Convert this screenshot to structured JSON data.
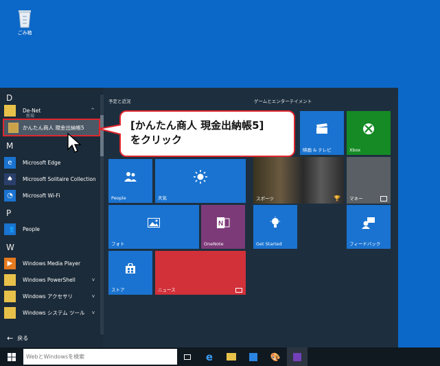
{
  "desktop": {
    "recycle_bin_label": "ごみ箱",
    "recycle_bin_icon": "recycle-bin-icon"
  },
  "start_menu": {
    "apps": {
      "letter_d": "D",
      "denet_label": "De-Net",
      "denet_sub": "新規",
      "highlight_label": "かんたん商人 現金出納帳5",
      "letter_m": "M",
      "edge_label": "Microsoft Edge",
      "solitaire_label": "Microsoft Solitaire Collection",
      "wifi_label": "Microsoft Wi-Fi",
      "letter_p": "P",
      "people_label": "People",
      "letter_w": "W",
      "wmp_label": "Windows Media Player",
      "powershell_label": "Windows PowerShell",
      "accessories_label": "Windows アクセサリ",
      "systemtools_label": "Windows システム ツール",
      "back_label": "戻る"
    },
    "groups": {
      "left_title": "予定と近況",
      "right_title": "ゲームとエンターテイメント"
    },
    "tiles": {
      "people": "People",
      "weather": "天気",
      "photo": "フォト",
      "onenote": "OneNote",
      "store": "ストア",
      "news": "ニュース",
      "movies": "映画 & テレビ",
      "xbox": "Xbox",
      "sports": "スポーツ",
      "money": "マネー",
      "getstarted": "Get Started",
      "feedback": "フィードバック"
    }
  },
  "callout": {
    "line1": "[かんたん商人 現金出納帳5]",
    "line2": "をクリック"
  },
  "taskbar": {
    "search_placeholder": "WebとWindowsを検索"
  },
  "colors": {
    "desktop": "#0c68c8",
    "tile_blue": "#1a73d0",
    "onenote": "#7c3a78",
    "news": "#d2313a",
    "xbox": "#158a25",
    "money": "#595f64",
    "callout_border": "#e0262d"
  }
}
